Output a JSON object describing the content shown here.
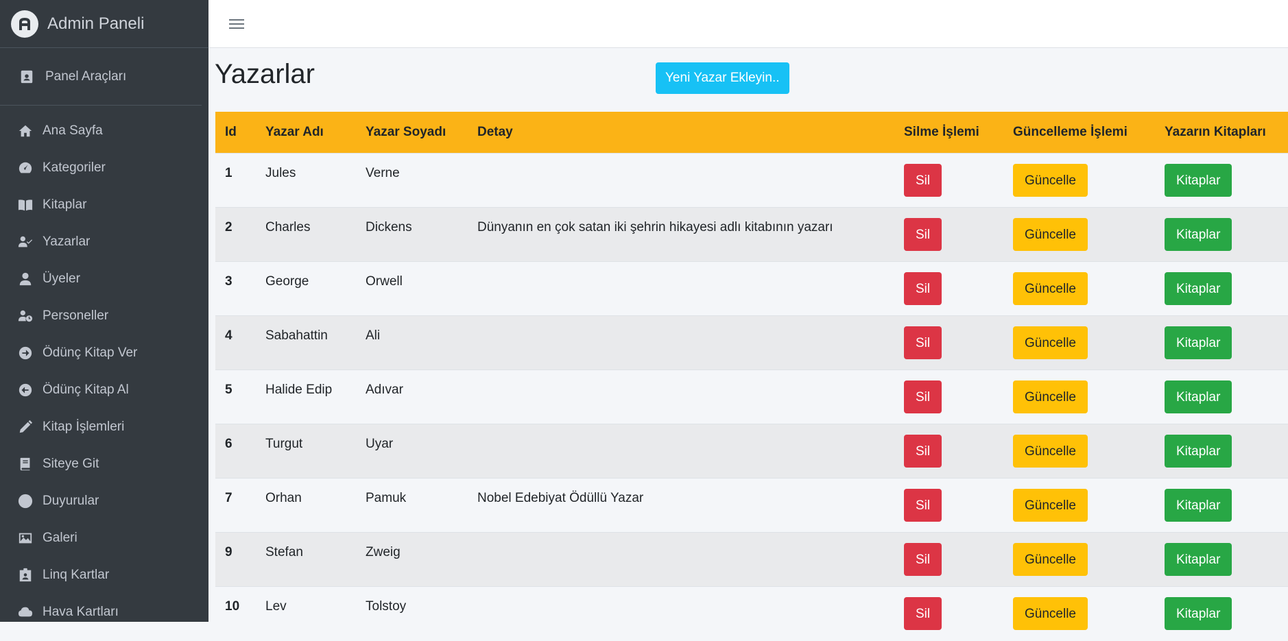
{
  "brand": {
    "title": "Admin Paneli"
  },
  "panel_tools": {
    "label": "Panel Araçları",
    "icon": "id-badge-icon"
  },
  "sidebar": {
    "items": [
      {
        "label": "Ana Sayfa",
        "icon": "home-icon"
      },
      {
        "label": "Kategoriler",
        "icon": "tachometer-icon"
      },
      {
        "label": "Kitaplar",
        "icon": "book-open-icon"
      },
      {
        "label": "Yazarlar",
        "icon": "user-check-icon"
      },
      {
        "label": "Üyeler",
        "icon": "user-icon"
      },
      {
        "label": "Personeller",
        "icon": "user-clock-icon"
      },
      {
        "label": "Ödünç Kitap Ver",
        "icon": "arrow-circle-right-icon"
      },
      {
        "label": "Ödünç Kitap Al",
        "icon": "arrow-circle-left-icon"
      },
      {
        "label": "Kitap İşlemleri",
        "icon": "pencil-icon"
      },
      {
        "label": "Siteye Git",
        "icon": "book-icon"
      },
      {
        "label": "Duyurular",
        "icon": "circle-icon"
      },
      {
        "label": "Galeri",
        "icon": "image-icon"
      },
      {
        "label": "Linq Kartlar",
        "icon": "id-card-icon"
      },
      {
        "label": "Hava Kartları",
        "icon": "cloud-download-icon"
      }
    ]
  },
  "page": {
    "title": "Yazarlar",
    "add_button": "Yeni Yazar Ekleyin.."
  },
  "table": {
    "headers": {
      "id": "Id",
      "name": "Yazar Adı",
      "surname": "Yazar Soyadı",
      "detail": "Detay",
      "delete": "Silme İşlemi",
      "update": "Güncelleme İşlemi",
      "books": "Yazarın Kitapları"
    },
    "button_labels": {
      "delete": "Sil",
      "update": "Güncelle",
      "books": "Kitaplar"
    },
    "rows": [
      {
        "id": "1",
        "name": "Jules",
        "surname": "Verne",
        "detail": ""
      },
      {
        "id": "2",
        "name": "Charles",
        "surname": "Dickens",
        "detail": "Dünyanın en çok satan iki şehrin hikayesi adlı kitabının yazarı"
      },
      {
        "id": "3",
        "name": "George",
        "surname": "Orwell",
        "detail": ""
      },
      {
        "id": "4",
        "name": "Sabahattin",
        "surname": "Ali",
        "detail": ""
      },
      {
        "id": "5",
        "name": "Halide Edip",
        "surname": "Adıvar",
        "detail": ""
      },
      {
        "id": "6",
        "name": "Turgut",
        "surname": "Uyar",
        "detail": ""
      },
      {
        "id": "7",
        "name": "Orhan",
        "surname": "Pamuk",
        "detail": "Nobel Edebiyat Ödüllü Yazar"
      },
      {
        "id": "9",
        "name": "Stefan",
        "surname": "Zweig",
        "detail": ""
      },
      {
        "id": "10",
        "name": "Lev",
        "surname": "Tolstoy",
        "detail": ""
      }
    ]
  },
  "colors": {
    "sidebar_bg": "#343a40",
    "header_bg": "#fbb316",
    "delete": "#dc3545",
    "update": "#ffc107",
    "books": "#28a745",
    "add": "#17c1f5"
  }
}
